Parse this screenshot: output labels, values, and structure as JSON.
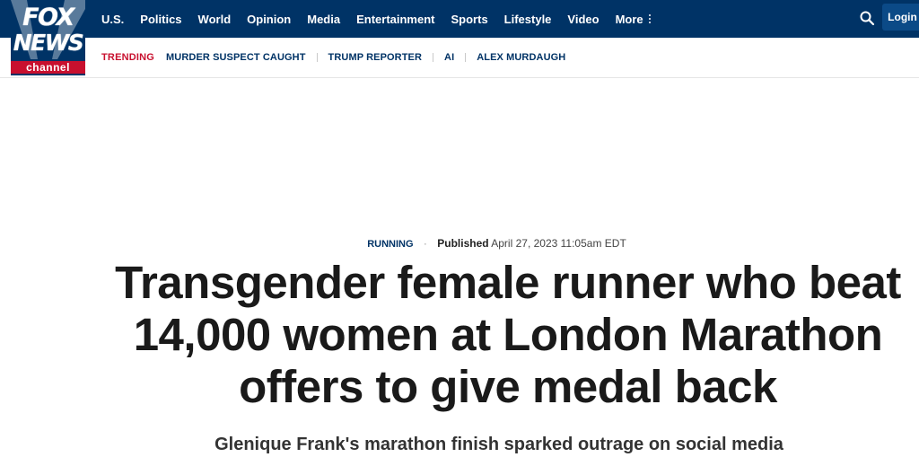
{
  "logo": {
    "fox": "FOX",
    "news": "NEWS",
    "channel": "channel"
  },
  "nav": {
    "items": [
      "U.S.",
      "Politics",
      "World",
      "Opinion",
      "Media",
      "Entertainment",
      "Sports",
      "Lifestyle",
      "Video"
    ],
    "more_label": "More",
    "login_label": "Login"
  },
  "trending": {
    "label": "TRENDING",
    "items": [
      "MURDER SUSPECT CAUGHT",
      "TRUMP REPORTER",
      "AI",
      "ALEX MURDAUGH"
    ]
  },
  "article": {
    "kicker": "RUNNING",
    "published_label": "Published",
    "published_date": "April 27, 2023 11:05am EDT",
    "headline": "Transgender female runner who beat 14,000 women at London Marathon offers to give medal back",
    "subhead": "Glenique Frank's marathon finish sparked outrage on social media"
  },
  "colors": {
    "nav_bg": "#003366",
    "accent_red": "#c8102e",
    "link_blue": "#003366"
  }
}
